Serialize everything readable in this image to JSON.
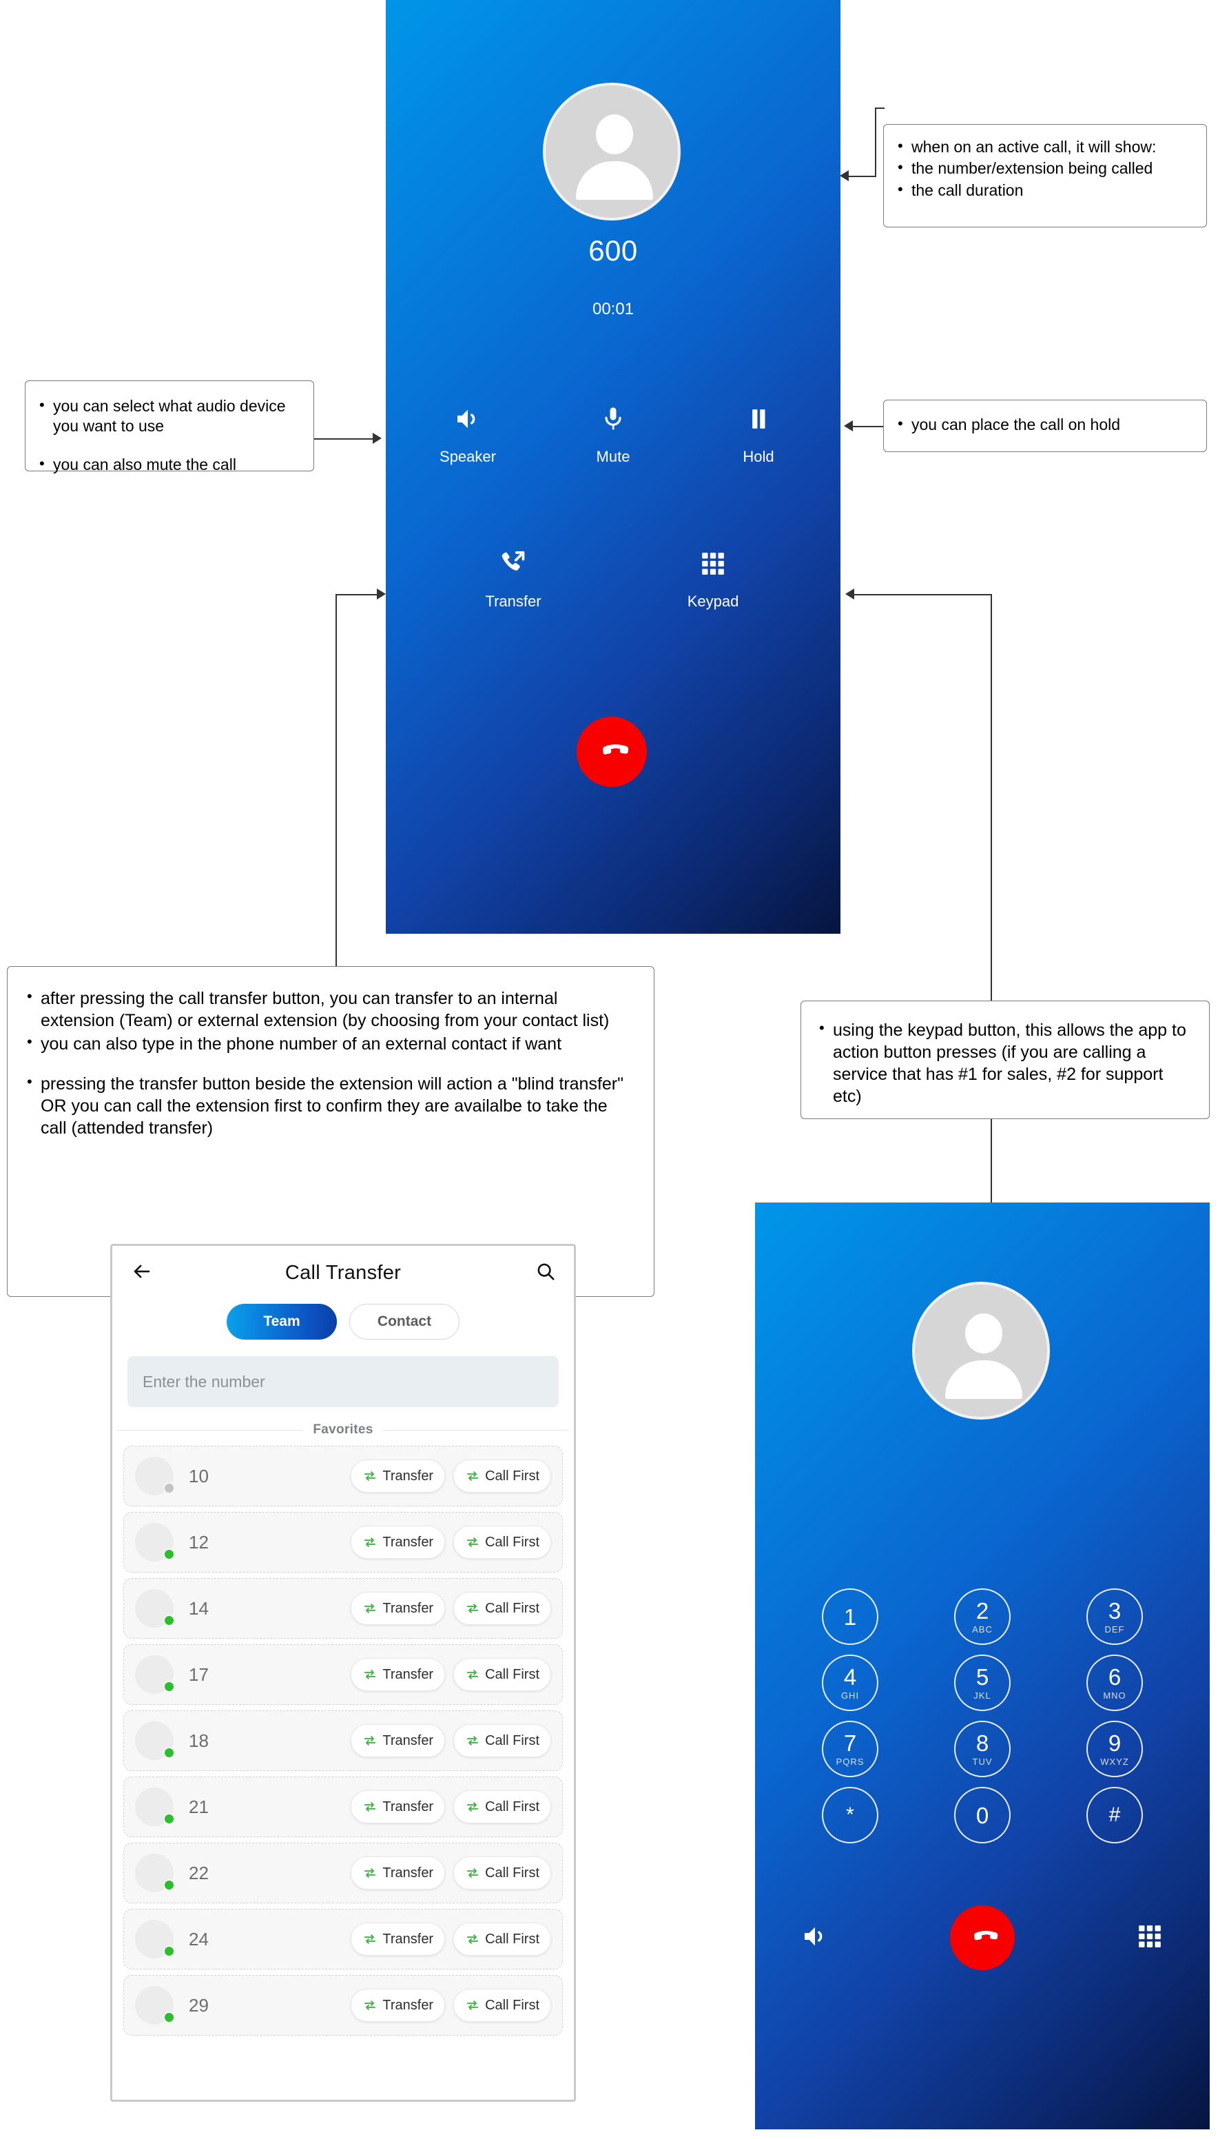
{
  "call_screen": {
    "number": "600",
    "duration": "00:01",
    "controls_row1": [
      {
        "label": "Speaker",
        "icon": "speaker-icon"
      },
      {
        "label": "Mute",
        "icon": "microphone-icon"
      },
      {
        "label": "Hold",
        "icon": "pause-icon"
      }
    ],
    "controls_row2": [
      {
        "label": "Transfer",
        "icon": "call-transfer-icon"
      },
      {
        "label": "Keypad",
        "icon": "keypad-grid-icon"
      }
    ],
    "end_call_icon": "end-call-icon"
  },
  "transfer_screen": {
    "title": "Call Transfer",
    "back_icon": "back-arrow-icon",
    "search_icon": "search-icon",
    "tabs": [
      {
        "label": "Team",
        "active": true
      },
      {
        "label": "Contact",
        "active": false
      }
    ],
    "number_input_placeholder": "Enter the number",
    "section_label": "Favorites",
    "button_labels": {
      "transfer": "Transfer",
      "call_first": "Call First"
    },
    "status_colors": {
      "online": "#2bbf2b",
      "offline": "#c4c4c4"
    },
    "rows": [
      {
        "extension": "10",
        "status": "offline"
      },
      {
        "extension": "12",
        "status": "online"
      },
      {
        "extension": "14",
        "status": "online"
      },
      {
        "extension": "17",
        "status": "online"
      },
      {
        "extension": "18",
        "status": "online"
      },
      {
        "extension": "21",
        "status": "online"
      },
      {
        "extension": "22",
        "status": "online"
      },
      {
        "extension": "24",
        "status": "online"
      },
      {
        "extension": "29",
        "status": "online"
      }
    ]
  },
  "keypad_screen": {
    "keys": [
      {
        "digit": "1",
        "letters": ""
      },
      {
        "digit": "2",
        "letters": "ABC"
      },
      {
        "digit": "3",
        "letters": "DEF"
      },
      {
        "digit": "4",
        "letters": "GHI"
      },
      {
        "digit": "5",
        "letters": "JKL"
      },
      {
        "digit": "6",
        "letters": "MNO"
      },
      {
        "digit": "7",
        "letters": "PQRS"
      },
      {
        "digit": "8",
        "letters": "TUV"
      },
      {
        "digit": "9",
        "letters": "WXYZ"
      },
      {
        "digit": "*",
        "letters": ""
      },
      {
        "digit": "0",
        "letters": ""
      },
      {
        "digit": "#",
        "letters": ""
      }
    ],
    "bottom": {
      "speaker_icon": "speaker-icon",
      "end_call_icon": "end-call-icon",
      "keypad_icon": "keypad-grid-icon"
    }
  },
  "annotations": {
    "active_call": [
      "when on an active call, it will show:",
      "the number/extension being called",
      "the call duration"
    ],
    "audio": [
      "you can select what audio device you want to use",
      "you can also mute the call"
    ],
    "hold": [
      "you can place the call on hold"
    ],
    "transfer": [
      "after pressing the call transfer button, you can transfer to an internal extension (Team) or external extension (by choosing from your contact list)",
      "you can also type in the phone number of an external contact if want",
      "pressing the transfer button beside the extension will action a \"blind transfer\" OR you can call the extension first to confirm they are availalbe to take the call (attended transfer)"
    ],
    "keypad": [
      "using the keypad button, this allows the app to action button presses (if you are calling a service that has #1 for sales, #2 for support etc)"
    ]
  },
  "colors": {
    "accent_blue": "#0a66d0",
    "end_call_red": "#f80000",
    "online_green": "#2bbf2b"
  }
}
